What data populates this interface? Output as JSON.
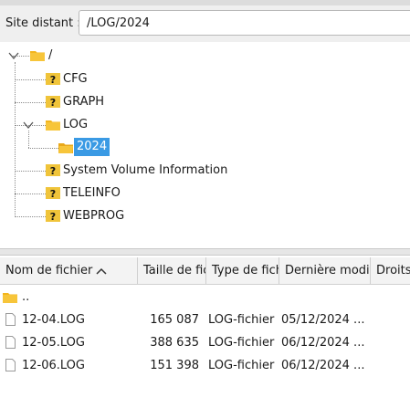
{
  "site": {
    "label": "Site distant :",
    "path": "/LOG/2024"
  },
  "tree": {
    "root": "/",
    "items": [
      {
        "label": "CFG"
      },
      {
        "label": "GRAPH"
      },
      {
        "label": "LOG"
      },
      {
        "label": "2024"
      },
      {
        "label": "System Volume Information"
      },
      {
        "label": "TELEINFO"
      },
      {
        "label": "WEBPROG"
      }
    ]
  },
  "filelist": {
    "columns": [
      "Nom de fichier",
      "Taille de fichier",
      "Type de fichier",
      "Dernière modification",
      "Droits"
    ],
    "parent": "..",
    "rows": [
      {
        "name": "12-04.LOG",
        "size": "165 087",
        "type": "LOG-fichier",
        "modified": "05/12/2024 ..."
      },
      {
        "name": "12-05.LOG",
        "size": "388 635",
        "type": "LOG-fichier",
        "modified": "06/12/2024 ..."
      },
      {
        "name": "12-06.LOG",
        "size": "151 398",
        "type": "LOG-fichier",
        "modified": "06/12/2024 ..."
      }
    ]
  },
  "colors": {
    "selection": "#3a9ae4",
    "folder": "#f3b51c",
    "unknown_folder": "#f0c43a"
  }
}
